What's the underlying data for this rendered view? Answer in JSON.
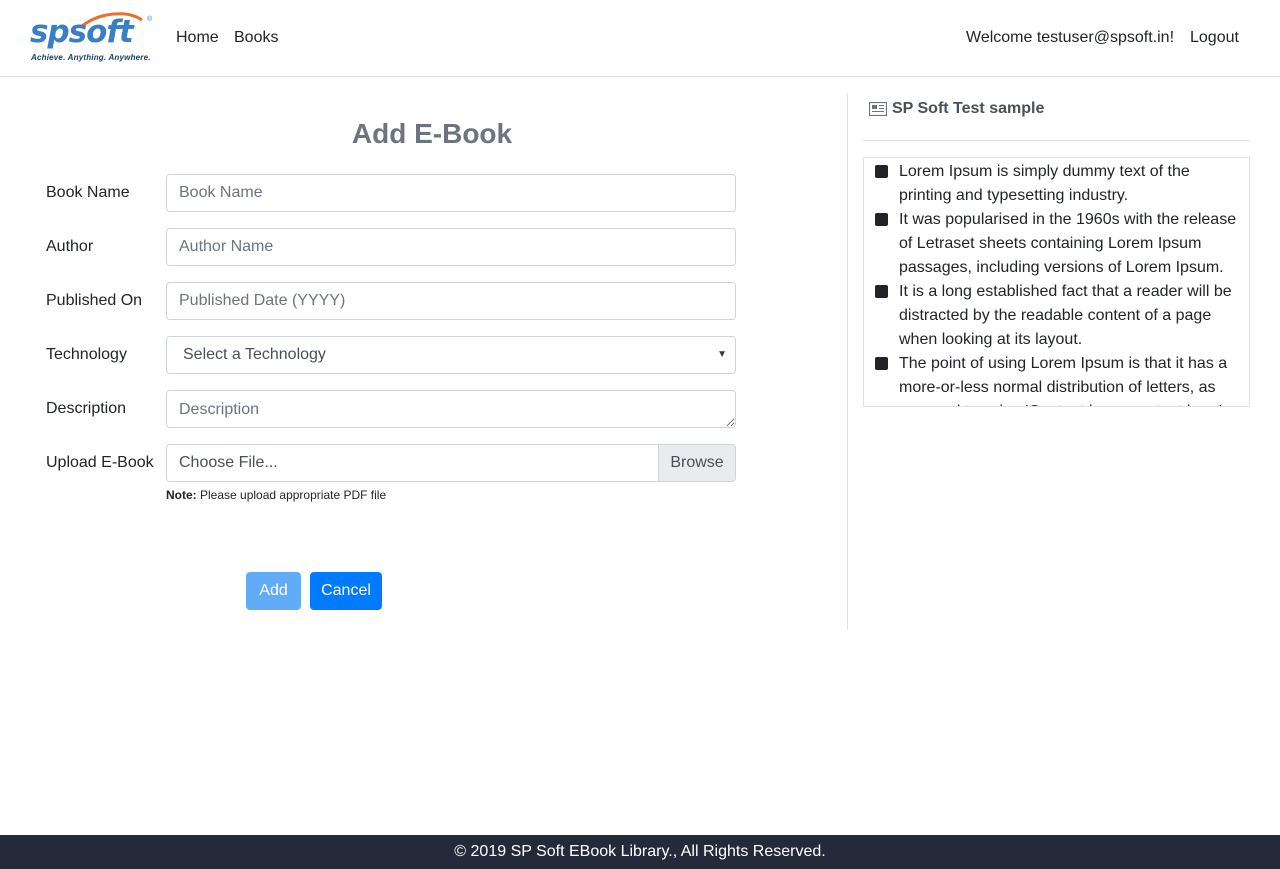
{
  "header": {
    "logo_text": "spsoft",
    "logo_registered": "®",
    "logo_tagline": "Achieve. Anything. Anywhere.",
    "nav": [
      {
        "label": "Home"
      },
      {
        "label": "Books"
      }
    ],
    "welcome": "Welcome testuser@spsoft.in!",
    "logout": "Logout"
  },
  "form": {
    "title": "Add E-Book",
    "book_name": {
      "label": "Book Name",
      "placeholder": "Book Name",
      "value": ""
    },
    "author": {
      "label": "Author",
      "placeholder": "Author Name",
      "value": ""
    },
    "published_on": {
      "label": "Published On",
      "placeholder": "Published Date (YYYY)",
      "value": ""
    },
    "technology": {
      "label": "Technology",
      "selected": "Select a Technology"
    },
    "description": {
      "label": "Description",
      "placeholder": "Description",
      "value": ""
    },
    "upload": {
      "label": "Upload E-Book",
      "file_text": "Choose File...",
      "browse": "Browse"
    },
    "note_label": "Note:",
    "note_text": "Please upload appropriate PDF file",
    "add_button": "Add",
    "cancel_button": "Cancel"
  },
  "sidebar": {
    "title": "SP Soft Test sample",
    "items": [
      "Lorem Ipsum is simply dummy text of the printing and typesetting industry.",
      "It was popularised in the 1960s with the release of Letraset sheets containing Lorem Ipsum passages, including versions of Lorem Ipsum.",
      "It is a long established fact that a reader will be distracted by the readable content of a page when looking at its layout.",
      "The point of using Lorem Ipsum is that it has a more-or-less normal distribution of letters, as opposed to using 'Content here, content here'."
    ]
  },
  "footer": {
    "text": "© 2019 SP Soft EBook Library., All Rights Reserved."
  },
  "colors": {
    "primary": "#007bff",
    "primary_disabled": "#62abf7",
    "footer_bg": "#252a3b",
    "logo_blue": "#3a7fc4",
    "logo_orange": "#e8702a"
  },
  "icons": {
    "sidebar_title_icon": "newspaper-icon",
    "select_caret": "caret-down-icon",
    "bullet": "square-bullet-icon"
  }
}
